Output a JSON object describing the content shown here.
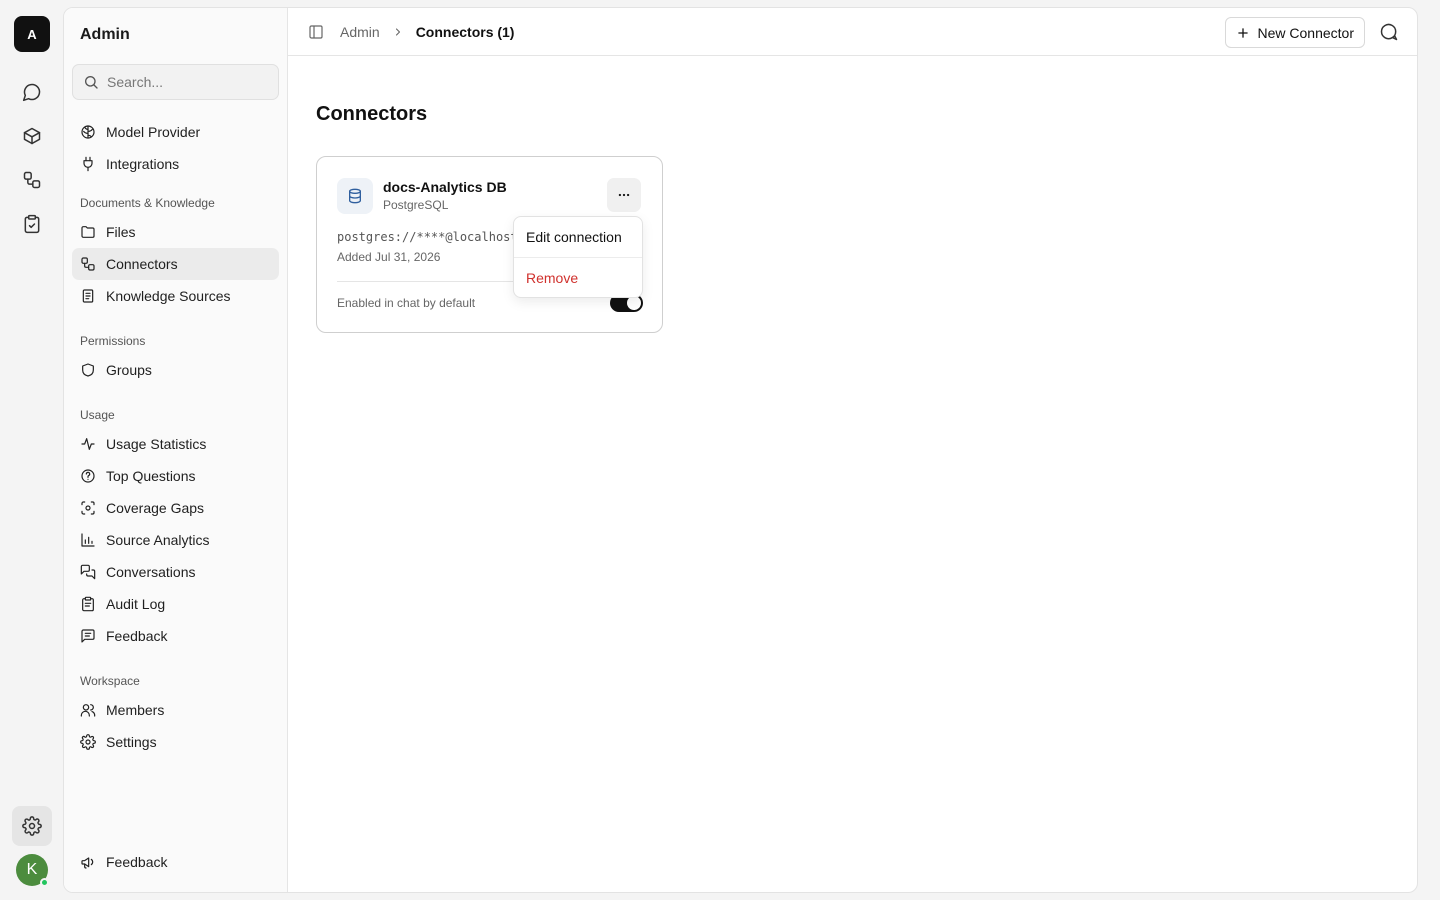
{
  "rail": {
    "logo_letter": "A",
    "avatar_letter": "K"
  },
  "sidebar": {
    "title": "Admin",
    "search_placeholder": "Search...",
    "top_items": [
      {
        "label": "Model Provider",
        "icon": "brain-icon"
      },
      {
        "label": "Integrations",
        "icon": "plug-icon"
      }
    ],
    "sections": [
      {
        "label": "Documents & Knowledge",
        "items": [
          {
            "label": "Files",
            "icon": "folder-icon"
          },
          {
            "label": "Connectors",
            "icon": "connector-icon",
            "active": true
          },
          {
            "label": "Knowledge Sources",
            "icon": "book-icon"
          }
        ]
      },
      {
        "label": "Permissions",
        "items": [
          {
            "label": "Groups",
            "icon": "shield-icon"
          }
        ]
      },
      {
        "label": "Usage",
        "items": [
          {
            "label": "Usage Statistics",
            "icon": "activity-icon"
          },
          {
            "label": "Top Questions",
            "icon": "question-icon"
          },
          {
            "label": "Coverage Gaps",
            "icon": "scan-icon"
          },
          {
            "label": "Source Analytics",
            "icon": "bar-chart-icon"
          },
          {
            "label": "Conversations",
            "icon": "messages-icon"
          },
          {
            "label": "Audit Log",
            "icon": "clipboard-icon"
          },
          {
            "label": "Feedback",
            "icon": "message-lines-icon"
          }
        ]
      },
      {
        "label": "Workspace",
        "items": [
          {
            "label": "Members",
            "icon": "users-icon"
          },
          {
            "label": "Settings",
            "icon": "gear-icon"
          }
        ]
      }
    ],
    "footer_item": {
      "label": "Feedback",
      "icon": "megaphone-icon"
    }
  },
  "header": {
    "breadcrumb_root": "Admin",
    "breadcrumb_current": "Connectors (1)",
    "new_button_label": "New Connector"
  },
  "main": {
    "title": "Connectors",
    "connector": {
      "name": "docs-Analytics DB",
      "type": "PostgreSQL",
      "connection_string": "postgres://****@localhost",
      "added": "Added Jul 31, 2026",
      "enabled_label": "Enabled in chat by default",
      "enabled": true
    },
    "menu": {
      "edit_label": "Edit connection",
      "remove_label": "Remove"
    }
  },
  "colors": {
    "accent": "#111111",
    "danger": "#d0312d",
    "avatar": "#4c8c3e"
  }
}
